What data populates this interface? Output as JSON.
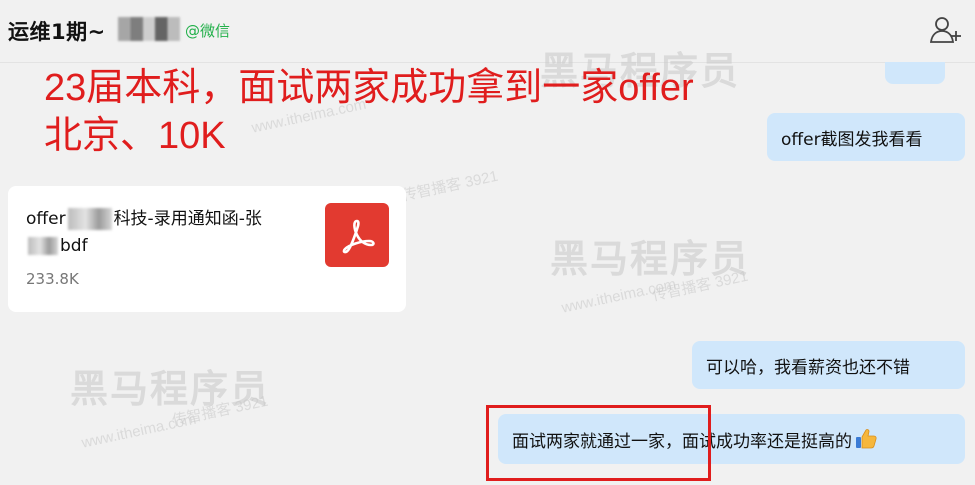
{
  "header": {
    "chat_title": "运维1期~",
    "wechat_tag": "@微信",
    "add_member_icon": "add-member-icon"
  },
  "annotation": {
    "line1": "23届本科，面试两家成功拿到一家offer",
    "line2": "北京、10K"
  },
  "watermark": {
    "brand": "黑马程序员",
    "url": "www.itheima.com",
    "tag": "传智播客 3921"
  },
  "messages": {
    "right_top": "offer截图发我看看",
    "file": {
      "name_prefix": "offer",
      "name_middle": "科技-录用通知函-张",
      "name_suffix": "bdf",
      "size": "233.8K",
      "icon": "pdf-icon"
    },
    "right_mid": "可以哈，我看薪资也还不错",
    "right_bottom": "面试两家就通过一家，面试成功率还是挺高的",
    "right_bottom_emoji": "thumbs-up-icon"
  },
  "colors": {
    "bubble": "#d0e7fb",
    "annotation": "#e01d1d",
    "pdf": "#e23a30",
    "wechat_green": "#22b04a"
  }
}
